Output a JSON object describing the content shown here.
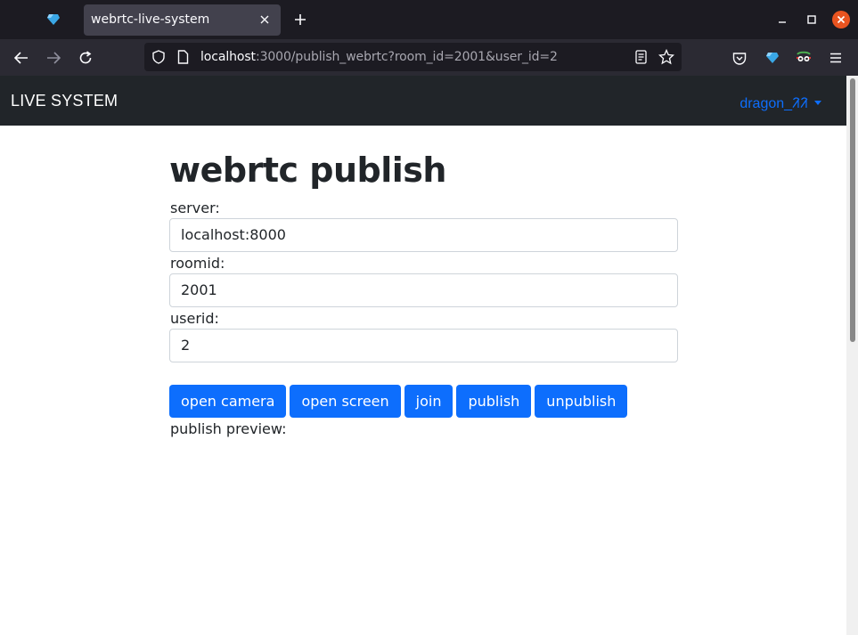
{
  "browser": {
    "tab_title": "webrtc-live-system",
    "url_host": "localhost",
    "url_rest": ":3000/publish_webrtc?room_id=2001&user_id=2"
  },
  "app": {
    "brand": "LIVE SYSTEM",
    "user_menu": "dragon_ᱤᱤ"
  },
  "page": {
    "title": "webrtc publish",
    "server_label": "server:",
    "server_value": "localhost:8000",
    "roomid_label": "roomid:",
    "roomid_value": "2001",
    "userid_label": "userid:",
    "userid_value": "2",
    "buttons": {
      "open_camera": "open camera",
      "open_screen": "open screen",
      "join": "join",
      "publish": "publish",
      "unpublish": "unpublish"
    },
    "preview_label": "publish preview:"
  },
  "colors": {
    "accent": "#0d6efd",
    "navbar": "#212529",
    "browser_bg": "#1c1b22"
  },
  "icons": [
    "gem-icon",
    "close-icon",
    "plus-icon",
    "minimize-icon",
    "maximize-icon",
    "window-close-icon",
    "back-icon",
    "forward-icon",
    "reload-icon",
    "shield-icon",
    "page-icon",
    "reader-icon",
    "star-icon",
    "pocket-icon",
    "extension-icon",
    "mask-icon",
    "menu-icon"
  ]
}
